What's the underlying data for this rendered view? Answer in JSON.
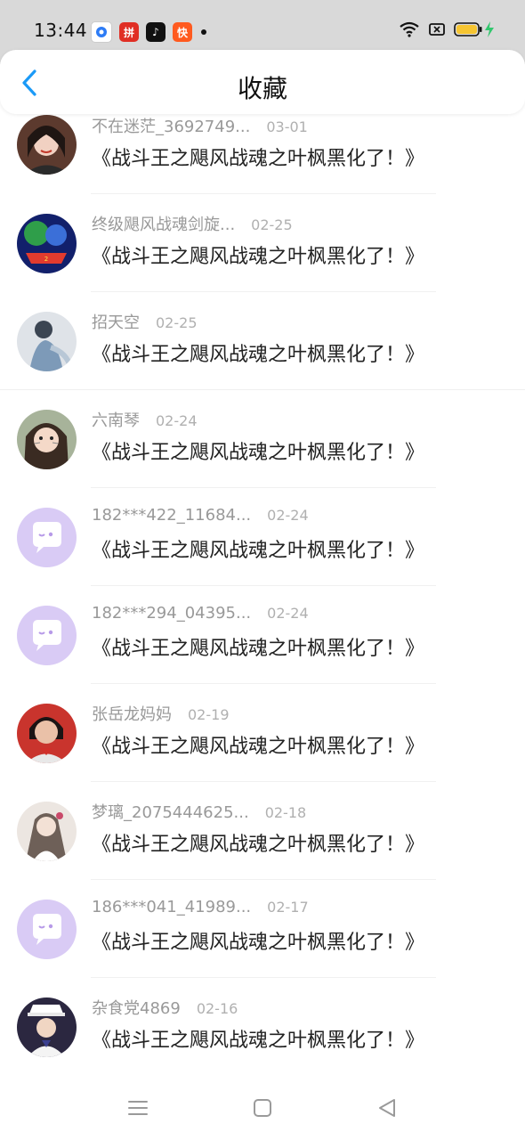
{
  "status_bar": {
    "time": "13:44",
    "apps": [
      "baidu-icon",
      "pinduoduo-icon",
      "tiktok-icon",
      "kuaishou-icon"
    ],
    "right_icons": [
      "wifi-icon",
      "sim-icon",
      "battery-icon",
      "charging-icon"
    ]
  },
  "header": {
    "title": "收藏",
    "back_icon": "chevron-left-icon"
  },
  "colors": {
    "accent": "#1b9af7",
    "placeholder_avatar": "#d9cbf5",
    "battery": "#f6c531",
    "charging": "#33c76e"
  },
  "items": [
    {
      "user": "不在迷茫_3692749...",
      "date": "03-01",
      "title": "《战斗王之飓风战魂之叶枫黑化了！》",
      "avatar": "photo"
    },
    {
      "user": "终级飓风战魂剑旋...",
      "date": "02-25",
      "title": "《战斗王之飓风战魂之叶枫黑化了！》",
      "avatar": "photo"
    },
    {
      "user": "招天空",
      "date": "02-25",
      "title": "《战斗王之飓风战魂之叶枫黑化了！》",
      "avatar": "photo"
    },
    {
      "user": "六南琴",
      "date": "02-24",
      "title": "《战斗王之飓风战魂之叶枫黑化了！》",
      "avatar": "photo"
    },
    {
      "user": "182***422_11684...",
      "date": "02-24",
      "title": "《战斗王之飓风战魂之叶枫黑化了！》",
      "avatar": "placeholder"
    },
    {
      "user": "182***294_04395...",
      "date": "02-24",
      "title": "《战斗王之飓风战魂之叶枫黑化了！》",
      "avatar": "placeholder"
    },
    {
      "user": "张岳龙妈妈",
      "date": "02-19",
      "title": "《战斗王之飓风战魂之叶枫黑化了！》",
      "avatar": "photo"
    },
    {
      "user": "梦璃_2075444625...",
      "date": "02-18",
      "title": "《战斗王之飓风战魂之叶枫黑化了！》",
      "avatar": "photo"
    },
    {
      "user": "186***041_41989...",
      "date": "02-17",
      "title": "《战斗王之飓风战魂之叶枫黑化了！》",
      "avatar": "placeholder"
    },
    {
      "user": "杂食党4869",
      "date": "02-16",
      "title": "《战斗王之飓风战魂之叶枫黑化了！》",
      "avatar": "photo"
    }
  ],
  "nav_bar": {
    "icons": [
      "menu-icon",
      "home-icon",
      "back-icon"
    ]
  }
}
